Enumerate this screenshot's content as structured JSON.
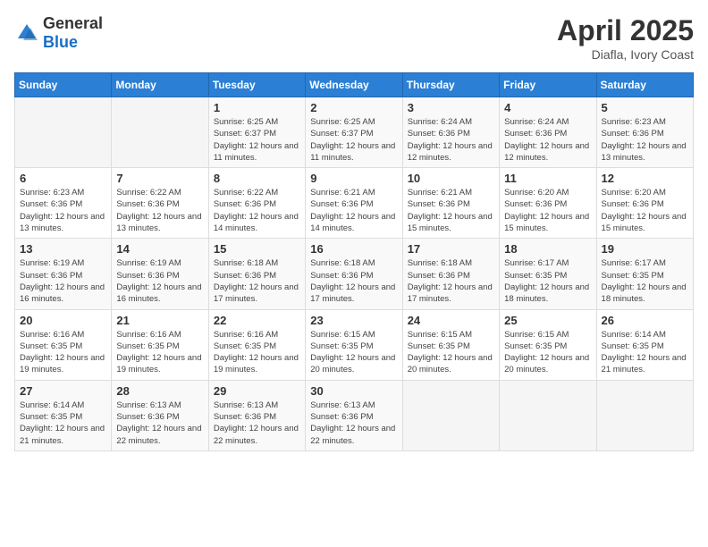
{
  "logo": {
    "general": "General",
    "blue": "Blue"
  },
  "title": "April 2025",
  "subtitle": "Diafla, Ivory Coast",
  "days_header": [
    "Sunday",
    "Monday",
    "Tuesday",
    "Wednesday",
    "Thursday",
    "Friday",
    "Saturday"
  ],
  "weeks": [
    [
      {
        "day": "",
        "info": ""
      },
      {
        "day": "",
        "info": ""
      },
      {
        "day": "1",
        "info": "Sunrise: 6:25 AM\nSunset: 6:37 PM\nDaylight: 12 hours and 11 minutes."
      },
      {
        "day": "2",
        "info": "Sunrise: 6:25 AM\nSunset: 6:37 PM\nDaylight: 12 hours and 11 minutes."
      },
      {
        "day": "3",
        "info": "Sunrise: 6:24 AM\nSunset: 6:36 PM\nDaylight: 12 hours and 12 minutes."
      },
      {
        "day": "4",
        "info": "Sunrise: 6:24 AM\nSunset: 6:36 PM\nDaylight: 12 hours and 12 minutes."
      },
      {
        "day": "5",
        "info": "Sunrise: 6:23 AM\nSunset: 6:36 PM\nDaylight: 12 hours and 13 minutes."
      }
    ],
    [
      {
        "day": "6",
        "info": "Sunrise: 6:23 AM\nSunset: 6:36 PM\nDaylight: 12 hours and 13 minutes."
      },
      {
        "day": "7",
        "info": "Sunrise: 6:22 AM\nSunset: 6:36 PM\nDaylight: 12 hours and 13 minutes."
      },
      {
        "day": "8",
        "info": "Sunrise: 6:22 AM\nSunset: 6:36 PM\nDaylight: 12 hours and 14 minutes."
      },
      {
        "day": "9",
        "info": "Sunrise: 6:21 AM\nSunset: 6:36 PM\nDaylight: 12 hours and 14 minutes."
      },
      {
        "day": "10",
        "info": "Sunrise: 6:21 AM\nSunset: 6:36 PM\nDaylight: 12 hours and 15 minutes."
      },
      {
        "day": "11",
        "info": "Sunrise: 6:20 AM\nSunset: 6:36 PM\nDaylight: 12 hours and 15 minutes."
      },
      {
        "day": "12",
        "info": "Sunrise: 6:20 AM\nSunset: 6:36 PM\nDaylight: 12 hours and 15 minutes."
      }
    ],
    [
      {
        "day": "13",
        "info": "Sunrise: 6:19 AM\nSunset: 6:36 PM\nDaylight: 12 hours and 16 minutes."
      },
      {
        "day": "14",
        "info": "Sunrise: 6:19 AM\nSunset: 6:36 PM\nDaylight: 12 hours and 16 minutes."
      },
      {
        "day": "15",
        "info": "Sunrise: 6:18 AM\nSunset: 6:36 PM\nDaylight: 12 hours and 17 minutes."
      },
      {
        "day": "16",
        "info": "Sunrise: 6:18 AM\nSunset: 6:36 PM\nDaylight: 12 hours and 17 minutes."
      },
      {
        "day": "17",
        "info": "Sunrise: 6:18 AM\nSunset: 6:36 PM\nDaylight: 12 hours and 17 minutes."
      },
      {
        "day": "18",
        "info": "Sunrise: 6:17 AM\nSunset: 6:35 PM\nDaylight: 12 hours and 18 minutes."
      },
      {
        "day": "19",
        "info": "Sunrise: 6:17 AM\nSunset: 6:35 PM\nDaylight: 12 hours and 18 minutes."
      }
    ],
    [
      {
        "day": "20",
        "info": "Sunrise: 6:16 AM\nSunset: 6:35 PM\nDaylight: 12 hours and 19 minutes."
      },
      {
        "day": "21",
        "info": "Sunrise: 6:16 AM\nSunset: 6:35 PM\nDaylight: 12 hours and 19 minutes."
      },
      {
        "day": "22",
        "info": "Sunrise: 6:16 AM\nSunset: 6:35 PM\nDaylight: 12 hours and 19 minutes."
      },
      {
        "day": "23",
        "info": "Sunrise: 6:15 AM\nSunset: 6:35 PM\nDaylight: 12 hours and 20 minutes."
      },
      {
        "day": "24",
        "info": "Sunrise: 6:15 AM\nSunset: 6:35 PM\nDaylight: 12 hours and 20 minutes."
      },
      {
        "day": "25",
        "info": "Sunrise: 6:15 AM\nSunset: 6:35 PM\nDaylight: 12 hours and 20 minutes."
      },
      {
        "day": "26",
        "info": "Sunrise: 6:14 AM\nSunset: 6:35 PM\nDaylight: 12 hours and 21 minutes."
      }
    ],
    [
      {
        "day": "27",
        "info": "Sunrise: 6:14 AM\nSunset: 6:35 PM\nDaylight: 12 hours and 21 minutes."
      },
      {
        "day": "28",
        "info": "Sunrise: 6:13 AM\nSunset: 6:36 PM\nDaylight: 12 hours and 22 minutes."
      },
      {
        "day": "29",
        "info": "Sunrise: 6:13 AM\nSunset: 6:36 PM\nDaylight: 12 hours and 22 minutes."
      },
      {
        "day": "30",
        "info": "Sunrise: 6:13 AM\nSunset: 6:36 PM\nDaylight: 12 hours and 22 minutes."
      },
      {
        "day": "",
        "info": ""
      },
      {
        "day": "",
        "info": ""
      },
      {
        "day": "",
        "info": ""
      }
    ]
  ]
}
